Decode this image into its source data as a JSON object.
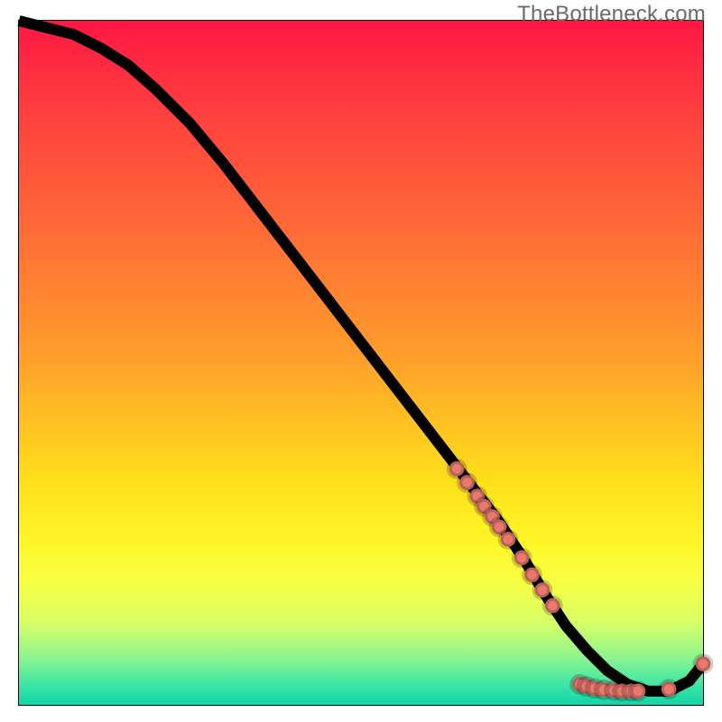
{
  "watermark": "TheBottleneck.com",
  "chart_data": {
    "type": "line",
    "title": "",
    "xlabel": "",
    "ylabel": "",
    "xlim": [
      0,
      100
    ],
    "ylim": [
      0,
      100
    ],
    "grid": false,
    "series": [
      {
        "name": "bottleneck-curve",
        "x": [
          0,
          4,
          8,
          12,
          16,
          20,
          25,
          30,
          35,
          40,
          45,
          50,
          55,
          60,
          65,
          70,
          74,
          77,
          80,
          83,
          86,
          89,
          92,
          95,
          98,
          100
        ],
        "y": [
          100,
          99,
          98,
          96,
          93.5,
          90,
          85,
          79,
          72.5,
          66,
          59.5,
          53,
          46.5,
          40,
          33.5,
          27,
          21,
          16,
          11.5,
          8,
          5,
          3,
          2,
          2,
          3.5,
          6
        ]
      }
    ],
    "points": [
      {
        "name": "cluster-descent-1",
        "x": 64.0,
        "y": 34.5
      },
      {
        "name": "cluster-descent-2",
        "x": 65.5,
        "y": 32.5
      },
      {
        "name": "cluster-descent-3",
        "x": 67.0,
        "y": 30.5
      },
      {
        "name": "cluster-descent-4",
        "x": 68.0,
        "y": 29.0
      },
      {
        "name": "cluster-descent-5",
        "x": 69.2,
        "y": 27.5
      },
      {
        "name": "cluster-descent-6",
        "x": 70.2,
        "y": 26.0
      },
      {
        "name": "cluster-descent-7",
        "x": 71.5,
        "y": 24.2
      },
      {
        "name": "cluster-descent-8",
        "x": 73.5,
        "y": 21.5
      },
      {
        "name": "cluster-descent-9",
        "x": 75.0,
        "y": 19.0
      },
      {
        "name": "cluster-descent-10",
        "x": 76.5,
        "y": 16.8
      },
      {
        "name": "cluster-descent-11",
        "x": 78.0,
        "y": 14.5
      },
      {
        "name": "bottom-1",
        "x": 82.0,
        "y": 3.0
      },
      {
        "name": "bottom-2",
        "x": 83.0,
        "y": 2.7
      },
      {
        "name": "bottom-3",
        "x": 84.2,
        "y": 2.4
      },
      {
        "name": "bottom-4",
        "x": 85.5,
        "y": 2.2
      },
      {
        "name": "bottom-5",
        "x": 87.0,
        "y": 2.1
      },
      {
        "name": "bottom-6",
        "x": 88.2,
        "y": 2.0
      },
      {
        "name": "bottom-7",
        "x": 89.5,
        "y": 2.0
      },
      {
        "name": "bottom-8",
        "x": 90.5,
        "y": 2.0
      },
      {
        "name": "bottom-9",
        "x": 95.0,
        "y": 2.3
      },
      {
        "name": "curve-end",
        "x": 100.0,
        "y": 6.0
      }
    ],
    "colors": {
      "point": "#e9796f",
      "line": "#000000"
    }
  }
}
